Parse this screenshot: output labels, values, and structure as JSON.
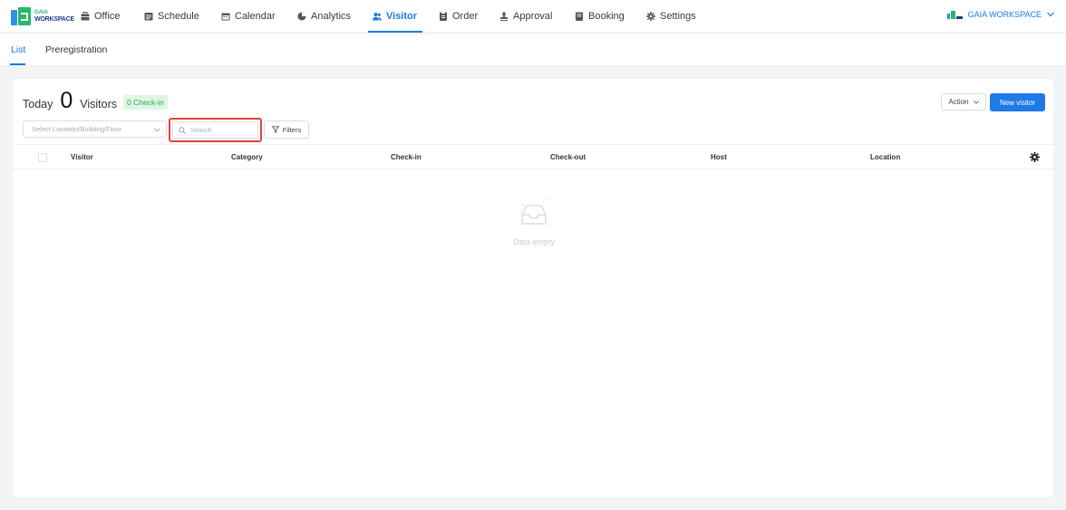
{
  "brand": {
    "logo_line1": "GAIA",
    "logo_line2": "WORKSPACE",
    "colors": {
      "primary": "#1d7ae6",
      "green": "#27b86a",
      "highlight": "#e0443a"
    }
  },
  "nav": {
    "items": [
      {
        "label": "Office",
        "icon": "briefcase-icon"
      },
      {
        "label": "Schedule",
        "icon": "schedule-icon"
      },
      {
        "label": "Calendar",
        "icon": "calendar-icon"
      },
      {
        "label": "Analytics",
        "icon": "pie-chart-icon"
      },
      {
        "label": "Visitor",
        "icon": "users-icon",
        "active": true
      },
      {
        "label": "Order",
        "icon": "clipboard-icon"
      },
      {
        "label": "Approval",
        "icon": "stamp-icon"
      },
      {
        "label": "Booking",
        "icon": "book-icon"
      },
      {
        "label": "Settings",
        "icon": "gear-icon"
      }
    ],
    "workspace": "GAIA WORKSPACE"
  },
  "subtabs": [
    {
      "label": "List",
      "active": true
    },
    {
      "label": "Preregistration"
    }
  ],
  "summary": {
    "today_label": "Today",
    "count": "0",
    "visitors_label": "Visitors",
    "checkin_badge": "0 Check-in"
  },
  "toolbar": {
    "action_label": "Action",
    "new_visitor_label": "New visitor",
    "location_placeholder": "Select Location/Building/Floor",
    "search_placeholder": "Search",
    "filters_label": "Filters"
  },
  "table": {
    "columns": [
      "Visitor",
      "Category",
      "Check-in",
      "Check-out",
      "Host",
      "Location"
    ],
    "rows": [],
    "empty_text": "Data empty"
  }
}
